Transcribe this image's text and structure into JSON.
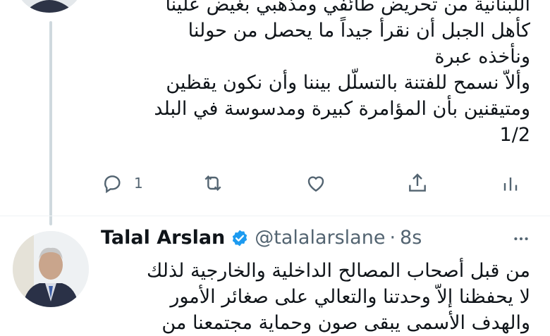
{
  "tweet1": {
    "text": "اللبنانية من تحريض طائفي ومذهبي بغيض علينا\nكأهل الجبل أن نقرأ جيداً ما يحصل من حولنا\nونأخذه عبرة\nوألاّ نسمح للفتنة بالتسلّل بيننا وأن نكون يقظين\nومتيقنين بأن المؤامرة كبيرة ومدسوسة في البلد\n1/2",
    "actions": {
      "reply_icon": "speech-bubble-icon",
      "reply_count": "1",
      "retweet_icon": "retweet-icon",
      "like_icon": "heart-icon",
      "share_icon": "share-icon",
      "analytics_icon": "bar-chart-icon"
    }
  },
  "tweet2": {
    "author_name": "Talal Arslan",
    "handle": "@talalarslane",
    "separator": "·",
    "time": "8s",
    "verified_icon": "verified-badge-icon",
    "more_icon": "more-dots-icon",
    "text": "من قبل أصحاب المصالح الداخلية والخارجية لذلك\nلا يحفظنا إلاّ وحدتنا والتعالي على صغائر الأمور\nوالهدف الأسمى يبقى صون وحماية مجتمعنا من"
  },
  "colors": {
    "text": "#0f1419",
    "muted": "#536471",
    "verified": "#1d9bf0",
    "thread_line": "#cfd9de"
  }
}
